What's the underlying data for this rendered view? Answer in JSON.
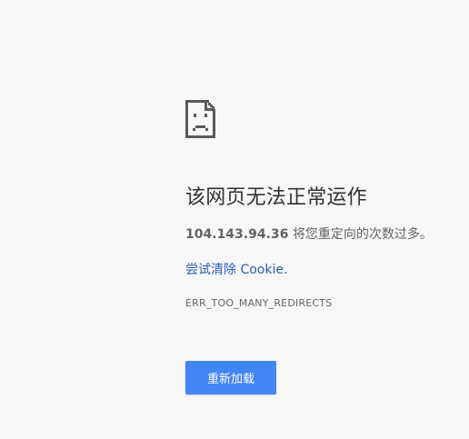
{
  "error_page": {
    "icon": "sad-document-icon",
    "title": "该网页无法正常运作",
    "message_host": "104.143.94.36",
    "message_text": " 将您重定向的次数过多。",
    "suggestion_link": "尝试清除 Cookie.",
    "error_code": "ERR_TOO_MANY_REDIRECTS",
    "reload_button_label": "重新加载"
  },
  "colors": {
    "background": "#f7f7f7",
    "title": "#333333",
    "body_text": "#646464",
    "link": "#2f5bb7",
    "button": "#4285f4",
    "button_text": "#ffffff"
  }
}
